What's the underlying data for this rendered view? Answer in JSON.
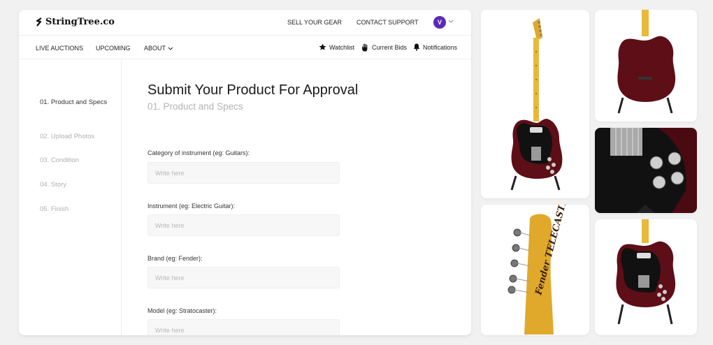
{
  "brand": {
    "name": "StringTree.co"
  },
  "topbar": {
    "links": [
      "SELL YOUR GEAR",
      "CONTACT SUPPORT"
    ],
    "avatar_initial": "V"
  },
  "nav": {
    "left": [
      "LIVE AUCTIONS",
      "UPCOMING",
      "ABOUT"
    ],
    "right": [
      "Watchlist",
      "Current Bids",
      "Notifications"
    ]
  },
  "sidebar": {
    "steps": [
      {
        "label": "01. Product and Specs",
        "active": true
      },
      {
        "label": "02. Upload Photos",
        "active": false
      },
      {
        "label": "03. Condition",
        "active": false
      },
      {
        "label": "04. Story",
        "active": false
      },
      {
        "label": "05. Finish",
        "active": false
      }
    ]
  },
  "form": {
    "title": "Submit Your Product For Approval",
    "subtitle": "01. Product and Specs",
    "fields": [
      {
        "label": "Category of instrument (eg: Guitars):",
        "placeholder": "Write here",
        "value": ""
      },
      {
        "label": "Instrument (eg: Electric Guitar):",
        "placeholder": "Write here",
        "value": ""
      },
      {
        "label": "Brand (eg: Fender):",
        "placeholder": "Write here",
        "value": ""
      },
      {
        "label": "Model (eg: Stratocaster):",
        "placeholder": "Write here",
        "value": ""
      }
    ]
  },
  "gallery": {
    "headstock_text": "Fender TELECASTER",
    "colors": {
      "body": "#5e0e17",
      "maple": "#e8b93a",
      "pickguard": "#111111"
    }
  },
  "colors": {
    "accent": "#5b2ab5",
    "background": "#f1f1f1"
  }
}
